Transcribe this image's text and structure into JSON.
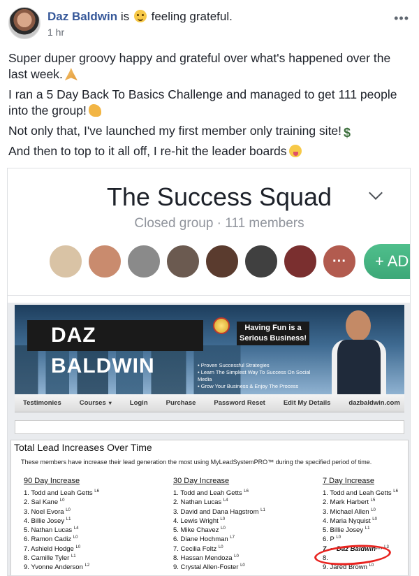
{
  "post": {
    "author": "Daz Baldwin",
    "is": "is",
    "feeling": "feeling grateful.",
    "time": "1 hr",
    "paragraphs": [
      "Super duper groovy happy and grateful over what's happened over the last week.",
      "I ran a 5 Day Back To Basics Challenge and managed to get 111 people into the group!",
      "Not only that, I've launched my first member only training site!",
      "And then to top to it all off, I re-hit the leader boards"
    ],
    "emojis": [
      "folded-hands-icon",
      "flexed-biceps-icon",
      "dollar-icon",
      "squinting-tongue-icon"
    ]
  },
  "group": {
    "title": "The Success Squad",
    "meta": "Closed group · 111 members",
    "add_label": "+ AD",
    "more_label": "···",
    "member_colors": [
      "#d9c3a5",
      "#c98b6e",
      "#8a8a8a",
      "#6b5a50",
      "#5a3b2e",
      "#404040",
      "#7a2f2f",
      "#b25b4f"
    ]
  },
  "site": {
    "banner_name": "DAZ BALDWIN",
    "banner_tag": "Having Fun is a Serious Business!",
    "bullets": [
      "Proven Successful Strategies",
      "Learn The Simplest Way To Success On Social Media",
      "Grow Your Business & Enjoy The Process"
    ],
    "nav": [
      "Testimonies",
      "Courses",
      "Login",
      "Purchase",
      "Password Reset",
      "Edit My Details",
      "dazbaldwin.com"
    ],
    "caret": "▾"
  },
  "leaderboard": {
    "title": "Total Lead Increases Over Time",
    "subtitle": "These members have increase their lead generation the most using MyLeadSystemPRO™ during the specified period of time.",
    "columns": [
      {
        "heading": "90 Day Increase",
        "rows": [
          {
            "name": "1. Todd and Leah Getts",
            "level": "L6"
          },
          {
            "name": "2. Sal Kane",
            "level": "L0"
          },
          {
            "name": "3. Noel Evora",
            "level": "L0"
          },
          {
            "name": "4. Billie Josey",
            "level": "L1"
          },
          {
            "name": "5. Nathan Lucas",
            "level": "L4"
          },
          {
            "name": "6. Ramon Cadiz",
            "level": "L0"
          },
          {
            "name": "7. Ashield Hodge",
            "level": "L0"
          },
          {
            "name": "8. Camille Tyler",
            "level": "L1"
          },
          {
            "name": "9. Yvonne Anderson",
            "level": "L2"
          }
        ]
      },
      {
        "heading": "30 Day Increase",
        "rows": [
          {
            "name": "1. Todd and Leah Getts",
            "level": "L6"
          },
          {
            "name": "2. Nathan Lucas",
            "level": "L4"
          },
          {
            "name": "3. David and Dana Hagstrom",
            "level": "L1"
          },
          {
            "name": "4. Lewis Wright",
            "level": "L0"
          },
          {
            "name": "5. Mike Chavez",
            "level": "L0"
          },
          {
            "name": "6. Diane Hochman",
            "level": "L7"
          },
          {
            "name": "7. Cecilia Foltz",
            "level": "L0"
          },
          {
            "name": "8. Hassan Mendoza",
            "level": "L0"
          },
          {
            "name": "9. Crystal Allen-Foster",
            "level": "L0"
          }
        ]
      },
      {
        "heading": "7 Day Increase",
        "rows": [
          {
            "name": "1. Todd and Leah Getts",
            "level": "L6"
          },
          {
            "name": "2. Mark Harbert",
            "level": "L5"
          },
          {
            "name": "3. Michael Allen",
            "level": "L0"
          },
          {
            "name": "4. Maria Nyquist",
            "level": "L0"
          },
          {
            "name": "5. Billie Josey",
            "level": "L1"
          },
          {
            "name": "6. P",
            "level": "L0"
          },
          {
            "name": "7. ···Daz Baldwin···",
            "level": "L3"
          },
          {
            "name": "8.",
            "level": ""
          },
          {
            "name": "9. Jared Brown",
            "level": "L0"
          }
        ]
      }
    ]
  }
}
